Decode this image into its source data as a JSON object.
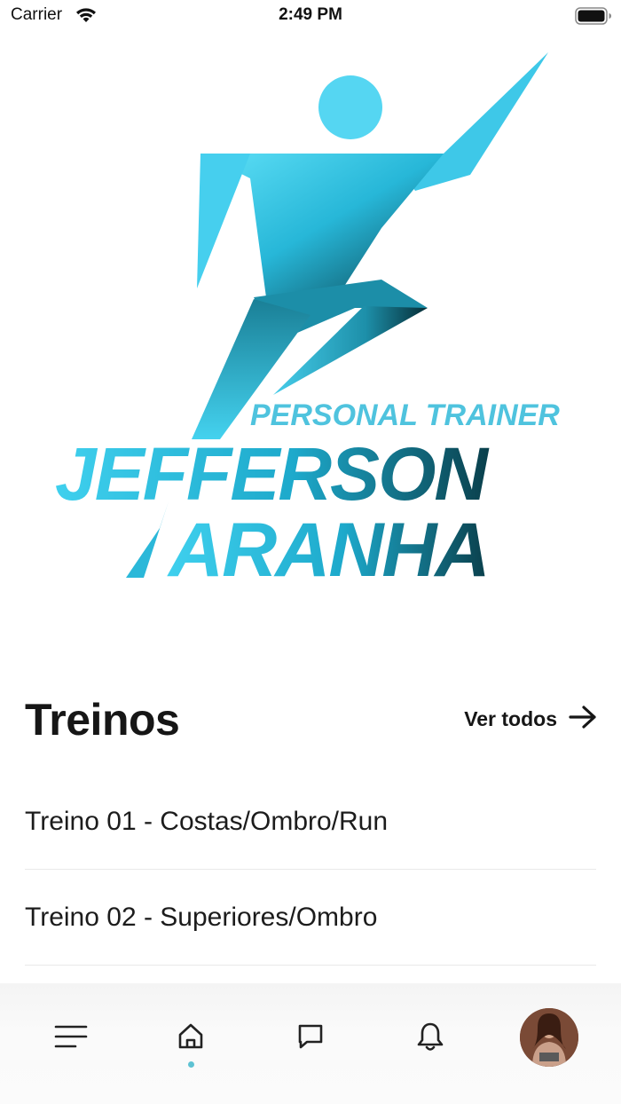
{
  "status_bar": {
    "carrier": "Carrier",
    "time": "2:49 PM"
  },
  "logo": {
    "line1": "PERSONAL TRAINER",
    "line2": "JEFFERSON",
    "line3": "ARANHA",
    "color_primary": "#33c6e6",
    "color_dark": "#0d4f5c"
  },
  "section": {
    "title": "Treinos",
    "see_all_label": "Ver todos"
  },
  "workouts": [
    {
      "label": "Treino 01 - Costas/Ombro/Run"
    },
    {
      "label": "Treino 02 - Superiores/Ombro"
    }
  ],
  "bottom_nav": {
    "items": [
      {
        "icon": "menu-icon"
      },
      {
        "icon": "home-icon",
        "active": true
      },
      {
        "icon": "chat-icon"
      },
      {
        "icon": "bell-icon"
      },
      {
        "icon": "avatar"
      }
    ],
    "active_color": "#5ec2d3"
  }
}
